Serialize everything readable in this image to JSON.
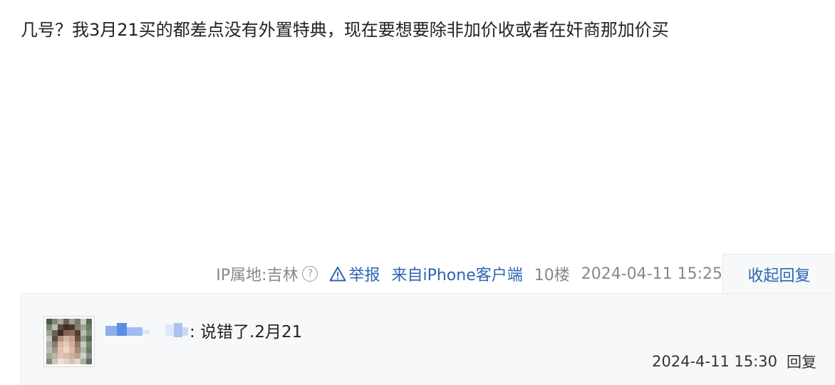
{
  "post": {
    "content": "几号？我3月21买的都差点没有外置特典，现在要想要除非加价收或者在奸商那加价买"
  },
  "meta": {
    "ip_location": "IP属地:吉林",
    "report_label": "举报",
    "source": "来自iPhone客户端",
    "floor": "10楼",
    "timestamp": "2024-04-11 15:25",
    "collapse_label": "收起回复"
  },
  "colors": {
    "link_blue": "#2d64b3",
    "meta_gray": "#888888",
    "panel_bg": "#f7f8fa"
  },
  "replies": [
    {
      "text": ": 说错了.2月21",
      "time": "2024-4-11 15:30",
      "reply_label": "回复"
    }
  ]
}
